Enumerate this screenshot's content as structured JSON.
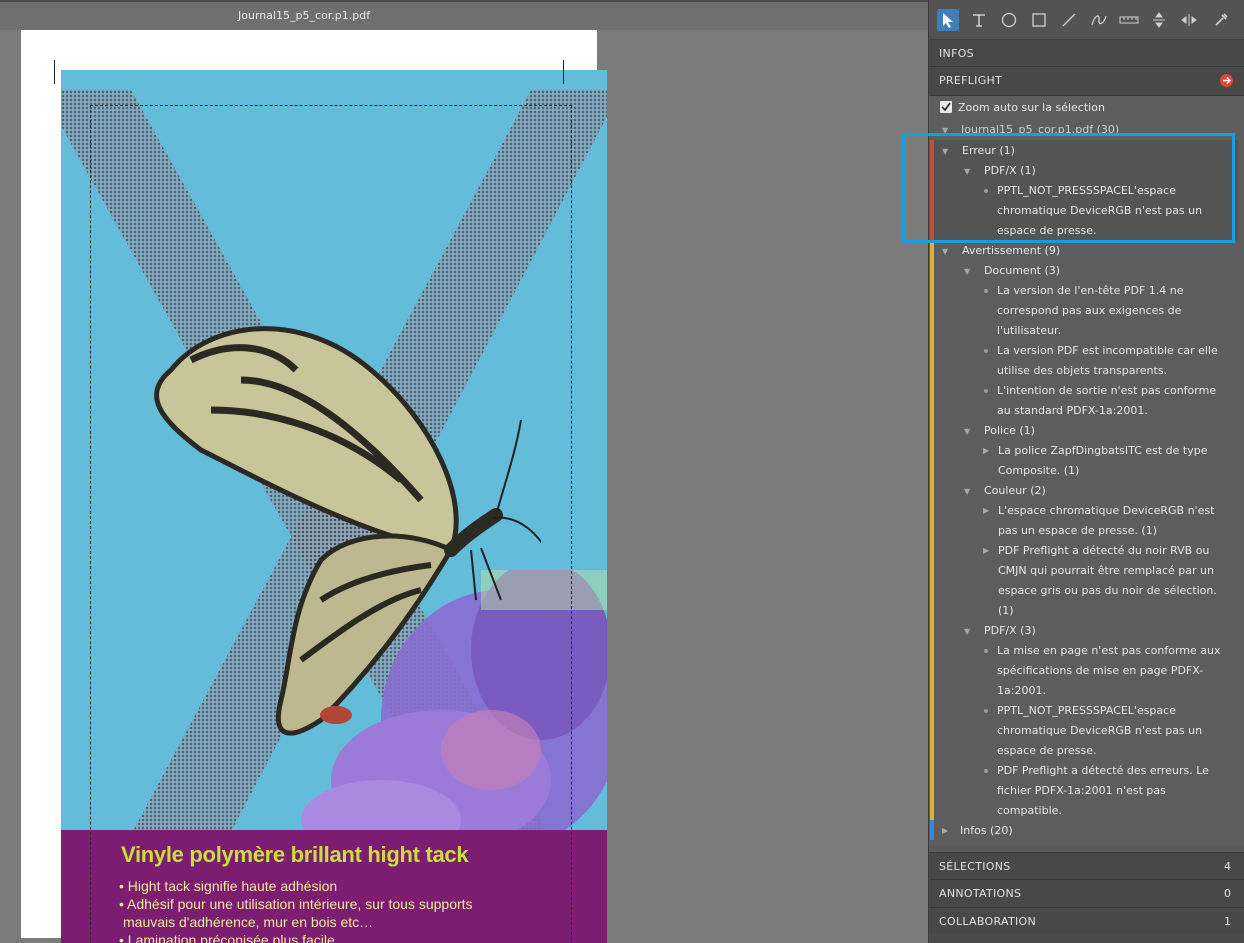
{
  "document": {
    "title": "Journal15_p5_cor.p1.pdf",
    "banner_title": "Vinyle polymère brillant hight tack",
    "banner_lines": [
      "• Hight tack signifie haute adhésion",
      "• Adhésif pour une utilisation intérieure, sur tous supports",
      "mauvais d'adhérence, mur en bois etc…",
      "• Lamination préconisée plus facile"
    ]
  },
  "toolbar": {
    "tools": [
      "select-arrow-icon",
      "text-tool-icon",
      "ellipse-tool-icon",
      "rectangle-tool-icon",
      "line-tool-icon",
      "freehand-tool-icon",
      "ruler-tool-icon",
      "vertical-measure-icon",
      "horizontal-measure-icon",
      "eyedropper-icon"
    ]
  },
  "panel": {
    "infos_label": "INFOS",
    "preflight_label": "PREFLIGHT",
    "zoom_auto_label": "Zoom auto sur la sélection",
    "root_label": "Journal15_p5_cor.p1.pdf (30)",
    "error_group": {
      "label": "Erreur (1)",
      "sub_label": "PDF/X (1)",
      "lines": [
        "PPTL_NOT_PRESSSPACEL'espace",
        "chromatique DeviceRGB n'est pas un",
        "espace de presse."
      ]
    },
    "warning_group": {
      "label": "Avertissement (9)",
      "document_label": "Document (3)",
      "document_items": [
        [
          "La version de l'en-tête PDF 1.4 ne",
          "correspond pas aux exigences de",
          "l'utilisateur."
        ],
        [
          "La version PDF est incompatible car elle",
          "utilise des objets transparents."
        ],
        [
          "L'intention de sortie n'est pas conforme",
          "au standard PDFX-1a:2001."
        ]
      ],
      "police_label": "Police (1)",
      "police_items": [
        [
          "La police ZapfDingbatsITC est de type",
          "Composite. (1)"
        ]
      ],
      "couleur_label": "Couleur (2)",
      "couleur_items": [
        [
          "L'espace chromatique DeviceRGB n'est",
          "pas un espace de presse. (1)"
        ],
        [
          "PDF Preflight a détecté du noir RVB ou",
          "CMJN qui pourrait être remplacé par un",
          "espace gris ou pas du noir de sélection.",
          "(1)"
        ]
      ],
      "pdfx_label": "PDF/X (3)",
      "pdfx_items": [
        [
          "La mise en page n'est pas conforme aux",
          "spécifications de mise en page PDFX-",
          "1a:2001."
        ],
        [
          "PPTL_NOT_PRESSSPACEL'espace",
          "chromatique DeviceRGB n'est pas un",
          "espace de presse."
        ],
        [
          "PDF Preflight a détecté des erreurs. Le",
          "fichier PDFX-1a:2001 n'est pas",
          "compatible."
        ]
      ]
    },
    "infos_group_label": "Infos (20)",
    "selections_label": "SÉLECTIONS",
    "selections_count": "4",
    "annotations_label": "ANNOTATIONS",
    "annotations_count": "0",
    "collaboration_label": "COLLABORATION",
    "collaboration_count": "1"
  },
  "colors": {
    "error_bar": "#c0503e",
    "warning_bar": "#d8b431",
    "info_bar": "#3f86c8",
    "highlight": "#14a0e0",
    "sky": "#62bcda",
    "banner": "#7d1d72"
  }
}
